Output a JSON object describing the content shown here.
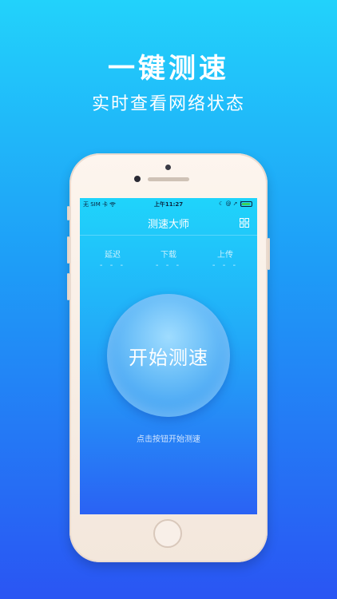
{
  "hero": {
    "title": "一键测速",
    "subtitle": "实时查看网络状态"
  },
  "status_bar": {
    "carrier": "无 SIM 卡",
    "time": "上午11:27",
    "battery_level": 0.9,
    "battery_color": "#3ad35a"
  },
  "app": {
    "title": "测速大师",
    "menu_icon": "grid-icon",
    "stats": [
      {
        "label": "延迟",
        "value": "- - -"
      },
      {
        "label": "下载",
        "value": "- - -"
      },
      {
        "label": "上传",
        "value": "- - -"
      }
    ],
    "start_button": "开始测速",
    "hint": "点击按钮开始测速"
  },
  "colors": {
    "background_top": "#22d2fb",
    "background_bottom": "#2a55f3"
  }
}
